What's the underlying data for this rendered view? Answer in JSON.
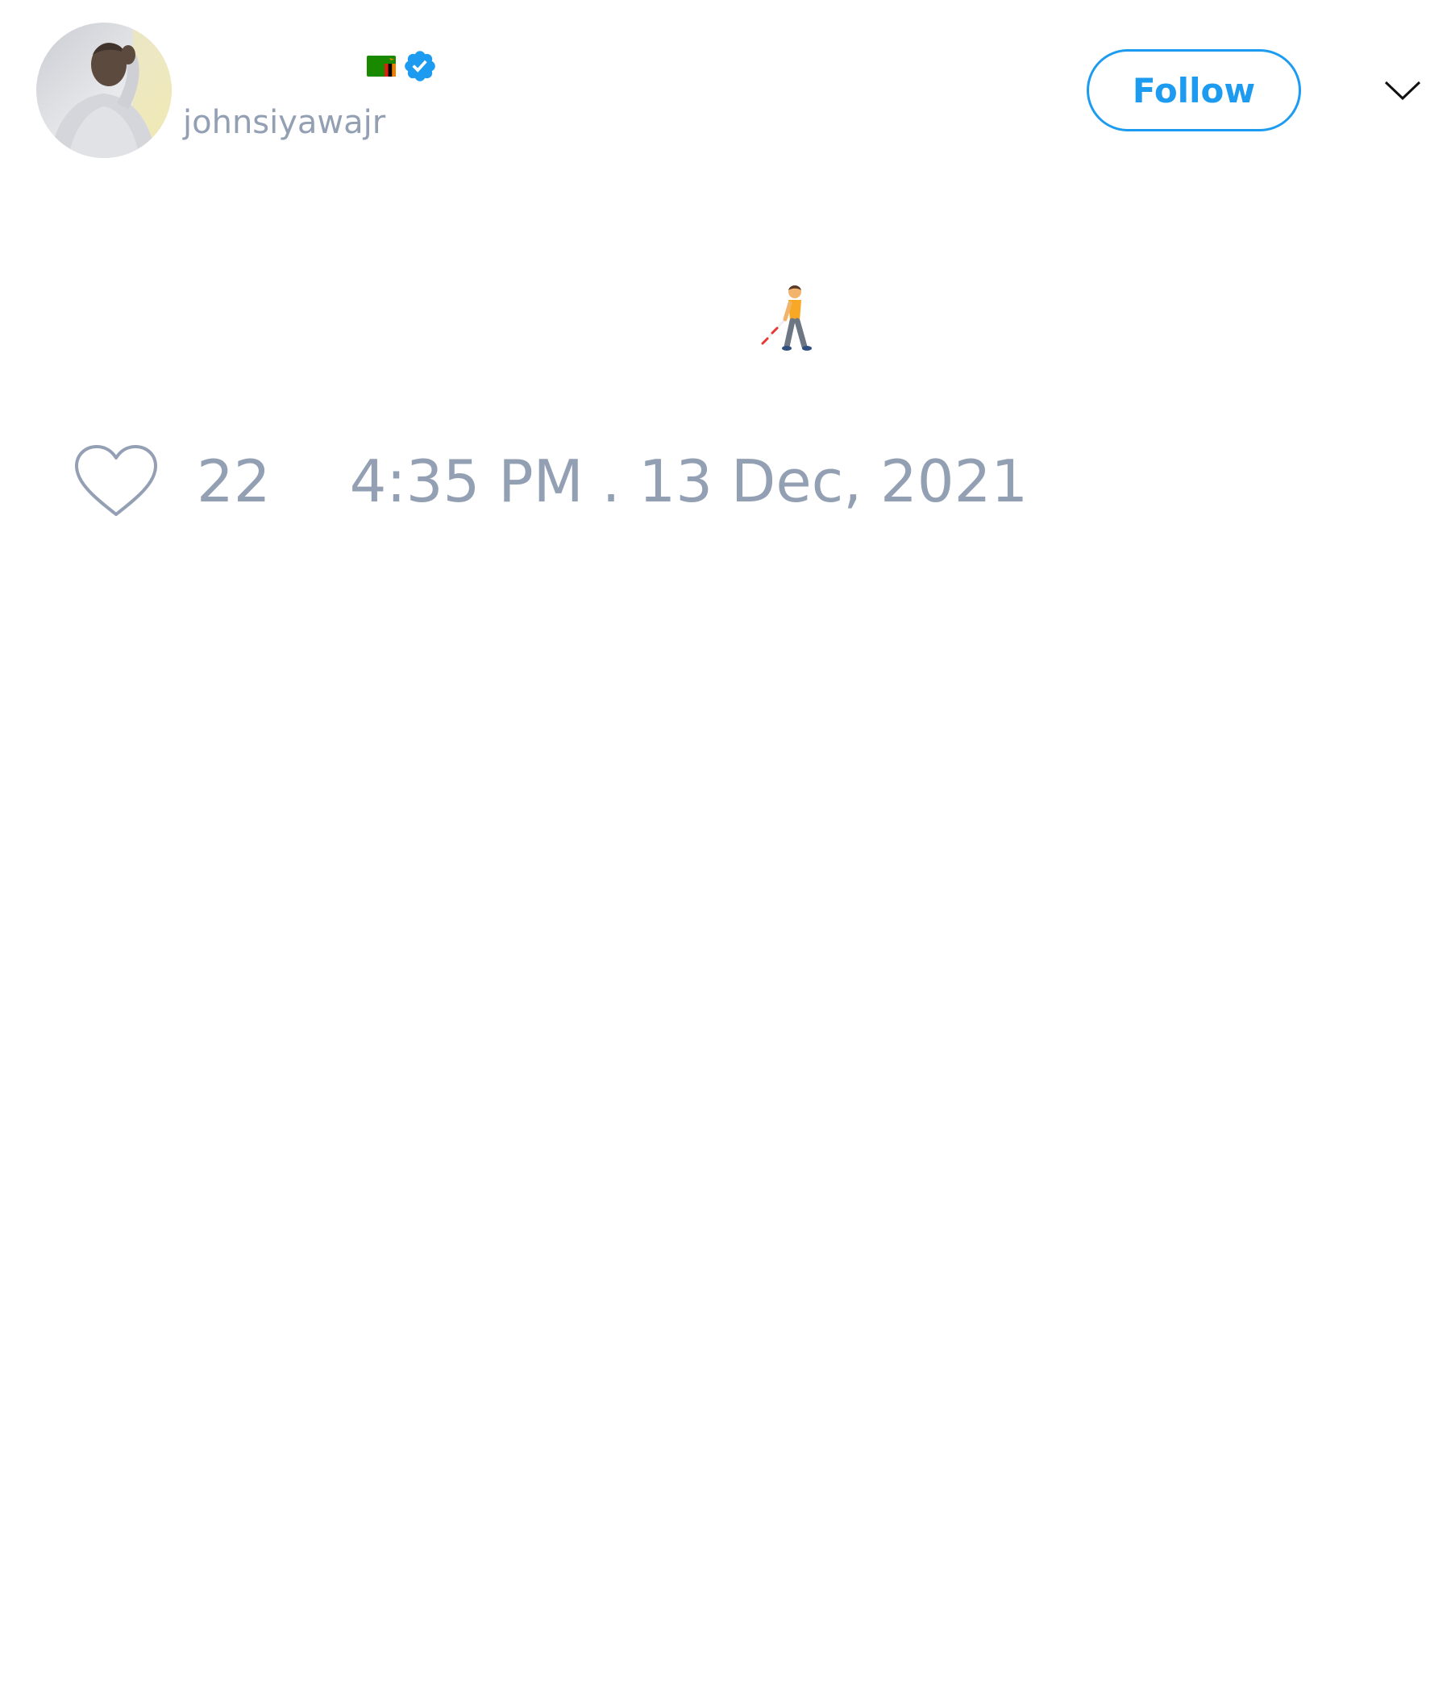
{
  "tweet": {
    "author": {
      "display_name": "",
      "username": "johnsiyawajr",
      "flag_icon": "zambia-flag-icon",
      "verified_icon": "verified-badge-icon",
      "avatar_icon": "avatar-photo"
    },
    "follow_button": {
      "label": "Follow"
    },
    "more_menu": {
      "icon": "chevron-down-icon"
    },
    "body": {
      "text": "👨‍🦯",
      "icon": "person-with-white-cane-emoji"
    },
    "footer": {
      "like_icon": "heart-icon",
      "like_count": "22",
      "timestamp": "4:35 PM . 13 Dec, 2021"
    }
  },
  "colors": {
    "accent": "#1d9bf0",
    "muted_text": "#93a0b4",
    "background": "#ffffff"
  }
}
